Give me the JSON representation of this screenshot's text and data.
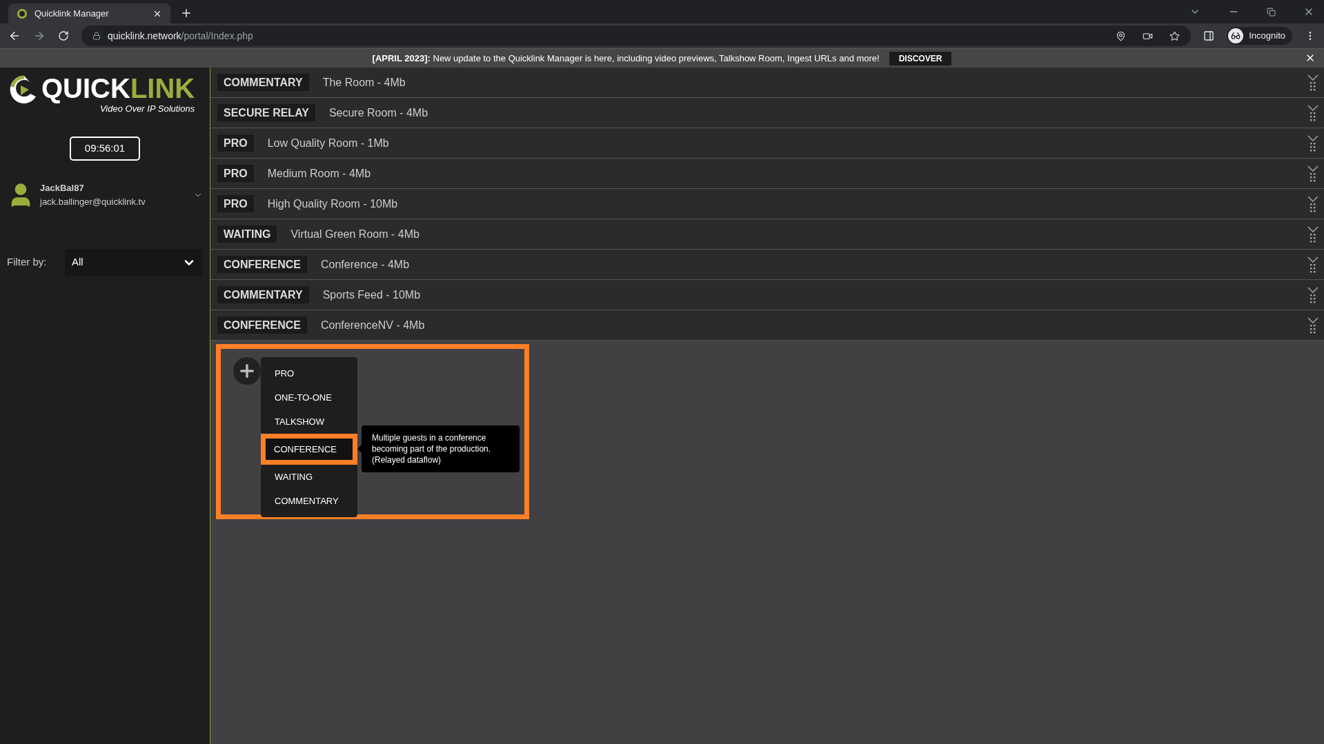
{
  "browser": {
    "tab_title": "Quicklink Manager",
    "url_host": "quicklink.network",
    "url_path": "/portal/Index.php",
    "profile": "Incognito"
  },
  "banner": {
    "text": "**[APRIL 2023]:** New update to the Quicklink Manager is here, including video previews, Talkshow Room, Ingest URLs and more!",
    "button": "DISCOVER"
  },
  "sidebar": {
    "logo": {
      "word_a": "QUICK",
      "word_b": "LINK",
      "tagline": "Video Over IP Solutions"
    },
    "clock": "09:56:01",
    "user": {
      "name": "JackBal87",
      "email": "jack.ballinger@quicklink.tv"
    },
    "filter": {
      "label": "Filter by:",
      "value": "All"
    }
  },
  "rooms": [
    {
      "type": "COMMENTARY",
      "name": "The Room - 4Mb"
    },
    {
      "type": "SECURE RELAY",
      "name": "Secure Room - 4Mb"
    },
    {
      "type": "PRO",
      "name": "Low Quality Room - 1Mb"
    },
    {
      "type": "PRO",
      "name": "Medium Room - 4Mb"
    },
    {
      "type": "PRO",
      "name": "High Quality Room - 10Mb"
    },
    {
      "type": "WAITING",
      "name": "Virtual Green Room - 4Mb"
    },
    {
      "type": "CONFERENCE",
      "name": "Conference - 4Mb"
    },
    {
      "type": "COMMENTARY",
      "name": "Sports Feed - 10Mb"
    },
    {
      "type": "CONFERENCE",
      "name": "ConferenceNV - 4Mb"
    }
  ],
  "add_menu": {
    "items": [
      {
        "label": "PRO",
        "selected": false
      },
      {
        "label": "ONE-TO-ONE",
        "selected": false
      },
      {
        "label": "TALKSHOW",
        "selected": false
      },
      {
        "label": "CONFERENCE",
        "selected": true
      },
      {
        "label": "WAITING",
        "selected": false
      },
      {
        "label": "COMMENTARY",
        "selected": false
      }
    ],
    "tooltip": "Multiple guests in a conference becoming part of the production. (Relayed dataflow)"
  }
}
